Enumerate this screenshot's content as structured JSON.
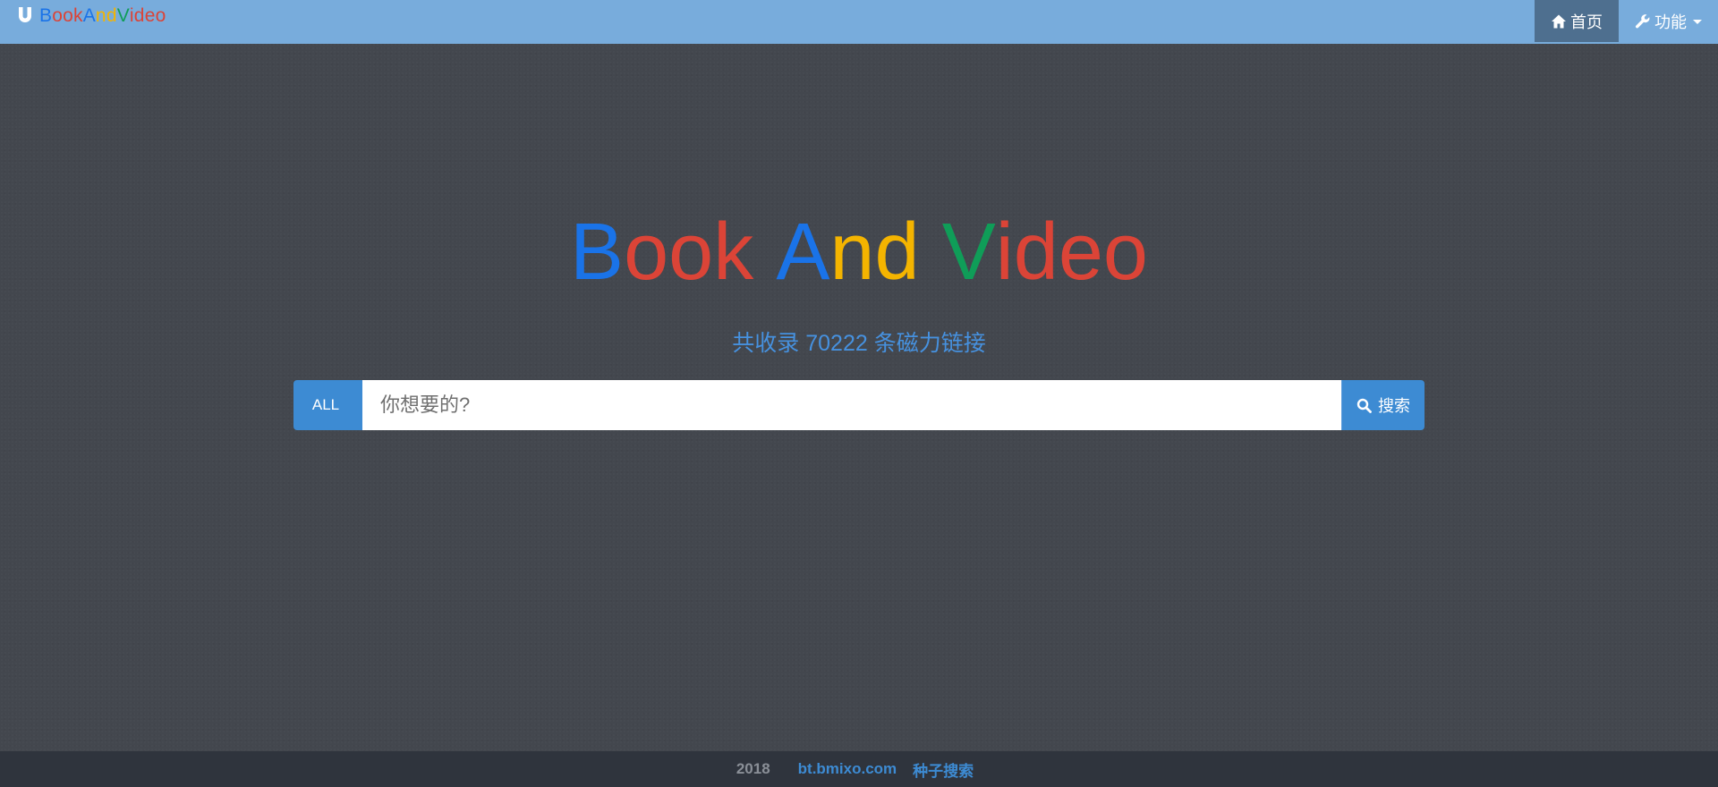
{
  "navbar": {
    "brand_letters": [
      {
        "char": "B",
        "color": "#1a73e8"
      },
      {
        "char": "o",
        "color": "#db4437"
      },
      {
        "char": "o",
        "color": "#db4437"
      },
      {
        "char": "k",
        "color": "#db4437"
      },
      {
        "char": "A",
        "color": "#1a73e8"
      },
      {
        "char": "n",
        "color": "#f4b400"
      },
      {
        "char": "d",
        "color": "#f4b400"
      },
      {
        "char": "V",
        "color": "#0f9d58"
      },
      {
        "char": "i",
        "color": "#db4437"
      },
      {
        "char": "d",
        "color": "#db4437"
      },
      {
        "char": "e",
        "color": "#db4437"
      },
      {
        "char": "o",
        "color": "#db4437"
      }
    ],
    "brand_icon": "magnet-icon",
    "items": [
      {
        "label": "首页",
        "icon": "home-icon",
        "active": true
      },
      {
        "label": "功能",
        "icon": "wrench-icon",
        "active": false,
        "dropdown": true
      }
    ],
    "bg_color": "#78acdc",
    "active_bg_color": "#4e6f8f"
  },
  "hero": {
    "title_letters": [
      {
        "char": "B",
        "color": "#1a73e8"
      },
      {
        "char": "o",
        "color": "#db4437"
      },
      {
        "char": "o",
        "color": "#db4437"
      },
      {
        "char": "k",
        "color": "#db4437"
      },
      {
        "char": " ",
        "color": "#ffffff"
      },
      {
        "char": "A",
        "color": "#1a73e8"
      },
      {
        "char": "n",
        "color": "#f4b400"
      },
      {
        "char": "d",
        "color": "#f4b400"
      },
      {
        "char": " ",
        "color": "#ffffff"
      },
      {
        "char": "V",
        "color": "#0f9d58"
      },
      {
        "char": "i",
        "color": "#db4437"
      },
      {
        "char": "d",
        "color": "#db4437"
      },
      {
        "char": "e",
        "color": "#db4437"
      },
      {
        "char": "o",
        "color": "#db4437"
      }
    ],
    "subtitle": "共收录 70222 条磁力链接"
  },
  "search": {
    "scope_label": "ALL",
    "placeholder": "你想要的?",
    "value": "",
    "button_label": "搜索",
    "button_icon": "search-icon",
    "accent_color": "#3d8bd3"
  },
  "footer": {
    "year": "2018",
    "site_link": "bt.bmixo.com",
    "tagline_link": "种子搜索"
  }
}
